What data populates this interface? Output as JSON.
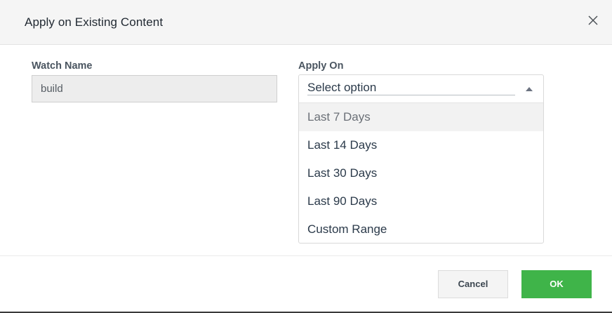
{
  "dialog": {
    "title": "Apply on Existing Content",
    "close_icon": "close-icon"
  },
  "watch_name": {
    "label": "Watch Name",
    "value": "build"
  },
  "apply_on": {
    "label": "Apply On",
    "placeholder": "Select option",
    "caret_icon": "caret-up-icon",
    "options": [
      {
        "label": "Last 7 Days",
        "highlighted": true
      },
      {
        "label": "Last 14 Days"
      },
      {
        "label": "Last 30 Days"
      },
      {
        "label": "Last 90 Days"
      },
      {
        "label": "Custom Range"
      }
    ]
  },
  "footer": {
    "cancel_label": "Cancel",
    "ok_label": "OK"
  },
  "colors": {
    "ok_button": "#3fb449",
    "header_bg": "#f5f5f5",
    "highlight_bg": "#f2f2f2"
  }
}
